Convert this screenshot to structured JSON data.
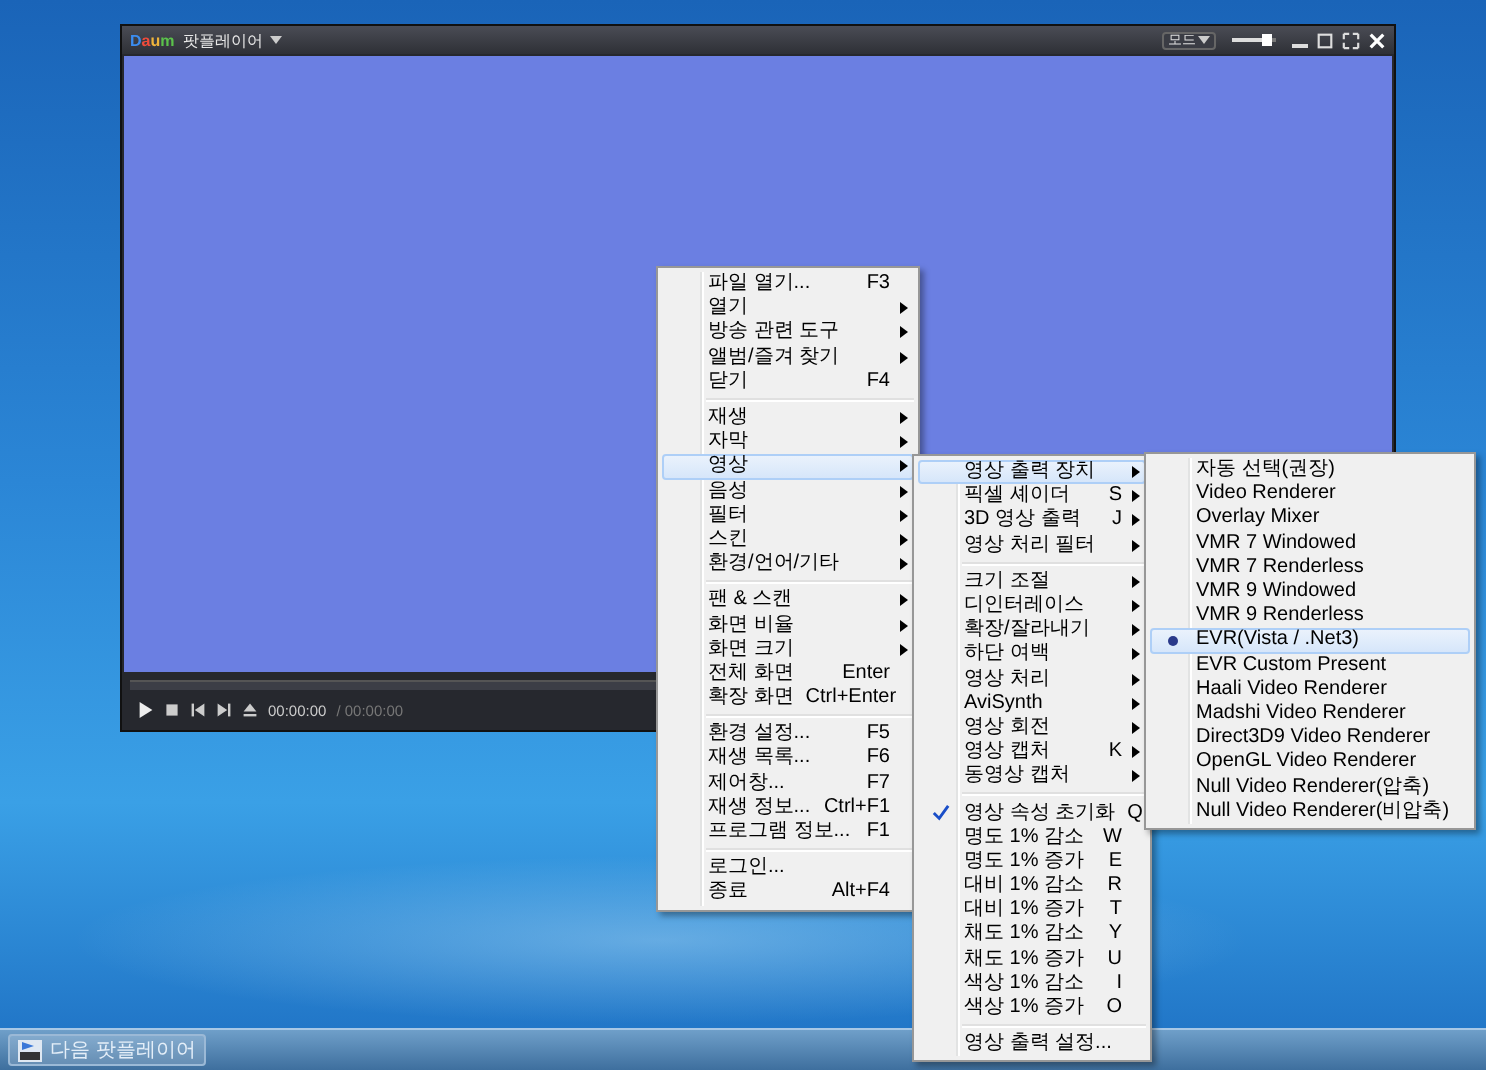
{
  "window": {
    "logo": "Daum",
    "title": "팟플레이어",
    "mode_button": "모드",
    "volume": {
      "level": 0.8
    }
  },
  "playback": {
    "elapsed": "00:00:00",
    "duration": "/ 00:00:00"
  },
  "menus": [
    {
      "items": [
        {
          "kind": "item",
          "label": "파일 열기...",
          "shortcut": "F3",
          "submenu": false,
          "selected": false
        },
        {
          "kind": "item",
          "label": "열기",
          "submenu": true,
          "selected": false
        },
        {
          "kind": "item",
          "label": "방송 관련 도구",
          "submenu": true,
          "selected": false
        },
        {
          "kind": "item",
          "label": "앨범/즐겨 찾기",
          "submenu": true,
          "selected": false
        },
        {
          "kind": "item",
          "label": "닫기",
          "shortcut": "F4",
          "submenu": false,
          "selected": false
        },
        {
          "kind": "separator"
        },
        {
          "kind": "item",
          "label": "재생",
          "submenu": true,
          "selected": false
        },
        {
          "kind": "item",
          "label": "자막",
          "submenu": true,
          "selected": false
        },
        {
          "kind": "item",
          "label": "영상",
          "submenu": true,
          "selected": true
        },
        {
          "kind": "item",
          "label": "음성",
          "submenu": true,
          "selected": false
        },
        {
          "kind": "item",
          "label": "필터",
          "submenu": true,
          "selected": false
        },
        {
          "kind": "item",
          "label": "스킨",
          "submenu": true,
          "selected": false
        },
        {
          "kind": "item",
          "label": "환경/언어/기타",
          "submenu": true,
          "selected": false
        },
        {
          "kind": "separator"
        },
        {
          "kind": "item",
          "label": "팬 & 스캔",
          "submenu": true,
          "selected": false
        },
        {
          "kind": "item",
          "label": "화면 비율",
          "submenu": true,
          "selected": false
        },
        {
          "kind": "item",
          "label": "화면 크기",
          "submenu": true,
          "selected": false
        },
        {
          "kind": "item",
          "label": "전체 화면",
          "shortcut": "Enter",
          "submenu": false,
          "selected": false
        },
        {
          "kind": "item",
          "label": "확장 화면",
          "shortcut": "Ctrl+Enter",
          "submenu": false,
          "selected": false
        },
        {
          "kind": "separator"
        },
        {
          "kind": "item",
          "label": "환경 설정...",
          "shortcut": "F5",
          "submenu": false,
          "selected": false
        },
        {
          "kind": "item",
          "label": "재생 목록...",
          "shortcut": "F6",
          "submenu": false,
          "selected": false
        },
        {
          "kind": "item",
          "label": "제어창...",
          "shortcut": "F7",
          "submenu": false,
          "selected": false
        },
        {
          "kind": "item",
          "label": "재생 정보...",
          "shortcut": "Ctrl+F1",
          "submenu": false,
          "selected": false
        },
        {
          "kind": "item",
          "label": "프로그램 정보...",
          "shortcut": "F1",
          "submenu": false,
          "selected": false
        },
        {
          "kind": "separator"
        },
        {
          "kind": "item",
          "label": "로그인...",
          "submenu": false,
          "selected": false
        },
        {
          "kind": "item",
          "label": "종료",
          "shortcut": "Alt+F4",
          "submenu": false,
          "selected": false
        }
      ]
    },
    {
      "items": [
        {
          "kind": "item",
          "label": "영상 출력 장치",
          "submenu": true,
          "selected": true,
          "checked": false
        },
        {
          "kind": "item",
          "label": "픽셀 셰이더",
          "shortcut": "S",
          "submenu": true,
          "selected": false,
          "checked": false
        },
        {
          "kind": "item",
          "label": "3D 영상 출력",
          "shortcut": "J",
          "submenu": true,
          "selected": false,
          "checked": false
        },
        {
          "kind": "item",
          "label": "영상 처리 필터",
          "submenu": true,
          "selected": false,
          "checked": false
        },
        {
          "kind": "separator"
        },
        {
          "kind": "item",
          "label": "크기 조절",
          "submenu": true,
          "selected": false,
          "checked": false
        },
        {
          "kind": "item",
          "label": "디인터레이스",
          "submenu": true,
          "selected": false,
          "checked": false
        },
        {
          "kind": "item",
          "label": "확장/잘라내기",
          "submenu": true,
          "selected": false,
          "checked": false
        },
        {
          "kind": "item",
          "label": "하단 여백",
          "submenu": true,
          "selected": false,
          "checked": false
        },
        {
          "kind": "item",
          "label": "영상 처리",
          "submenu": true,
          "selected": false,
          "checked": false
        },
        {
          "kind": "item",
          "label": "AviSynth",
          "submenu": true,
          "selected": false,
          "checked": false
        },
        {
          "kind": "item",
          "label": "영상 회전",
          "submenu": true,
          "selected": false,
          "checked": false
        },
        {
          "kind": "item",
          "label": "영상 캡처",
          "shortcut": "K",
          "submenu": true,
          "selected": false,
          "checked": false
        },
        {
          "kind": "item",
          "label": "동영상 캡처",
          "submenu": true,
          "selected": false,
          "checked": false
        },
        {
          "kind": "separator"
        },
        {
          "kind": "item",
          "label": "영상 속성 초기화",
          "shortcut": "Q",
          "submenu": false,
          "selected": false,
          "checked": true
        },
        {
          "kind": "item",
          "label": "명도 1% 감소",
          "shortcut": "W",
          "submenu": false,
          "selected": false,
          "checked": false
        },
        {
          "kind": "item",
          "label": "명도 1% 증가",
          "shortcut": "E",
          "submenu": false,
          "selected": false,
          "checked": false
        },
        {
          "kind": "item",
          "label": "대비 1% 감소",
          "shortcut": "R",
          "submenu": false,
          "selected": false,
          "checked": false
        },
        {
          "kind": "item",
          "label": "대비 1% 증가",
          "shortcut": "T",
          "submenu": false,
          "selected": false,
          "checked": false
        },
        {
          "kind": "item",
          "label": "채도 1% 감소",
          "shortcut": "Y",
          "submenu": false,
          "selected": false,
          "checked": false
        },
        {
          "kind": "item",
          "label": "채도 1% 증가",
          "shortcut": "U",
          "submenu": false,
          "selected": false,
          "checked": false
        },
        {
          "kind": "item",
          "label": "색상 1% 감소",
          "shortcut": "I",
          "submenu": false,
          "selected": false,
          "checked": false
        },
        {
          "kind": "item",
          "label": "색상 1% 증가",
          "shortcut": "O",
          "submenu": false,
          "selected": false,
          "checked": false
        },
        {
          "kind": "separator"
        },
        {
          "kind": "item",
          "label": "영상 출력 설정...",
          "submenu": false,
          "selected": false,
          "checked": false
        }
      ]
    },
    {
      "items": [
        {
          "kind": "radio",
          "label": "자동 선택(권장)",
          "selected": false,
          "checked": false
        },
        {
          "kind": "radio",
          "label": "Video Renderer",
          "selected": false,
          "checked": false
        },
        {
          "kind": "radio",
          "label": "Overlay Mixer",
          "selected": false,
          "checked": false
        },
        {
          "kind": "radio",
          "label": "VMR 7 Windowed",
          "selected": false,
          "checked": false
        },
        {
          "kind": "radio",
          "label": "VMR 7 Renderless",
          "selected": false,
          "checked": false
        },
        {
          "kind": "radio",
          "label": "VMR 9 Windowed",
          "selected": false,
          "checked": false
        },
        {
          "kind": "radio",
          "label": "VMR 9 Renderless",
          "selected": false,
          "checked": false
        },
        {
          "kind": "radio",
          "label": "EVR(Vista / .Net3)",
          "selected": true,
          "checked": true
        },
        {
          "kind": "radio",
          "label": "EVR Custom Present",
          "selected": false,
          "checked": false
        },
        {
          "kind": "radio",
          "label": "Haali Video Renderer",
          "selected": false,
          "checked": false
        },
        {
          "kind": "radio",
          "label": "Madshi Video Renderer",
          "selected": false,
          "checked": false
        },
        {
          "kind": "radio",
          "label": "Direct3D9 Video Renderer",
          "selected": false,
          "checked": false
        },
        {
          "kind": "radio",
          "label": "OpenGL Video Renderer",
          "selected": false,
          "checked": false
        },
        {
          "kind": "radio",
          "label": "Null Video Renderer(압축)",
          "selected": false,
          "checked": false
        },
        {
          "kind": "radio",
          "label": "Null Video Renderer(비압축)",
          "selected": false,
          "checked": false
        }
      ]
    }
  ],
  "taskbar": {
    "items": [
      {
        "label": "다음 팟플레이어",
        "selected": false
      }
    ]
  }
}
